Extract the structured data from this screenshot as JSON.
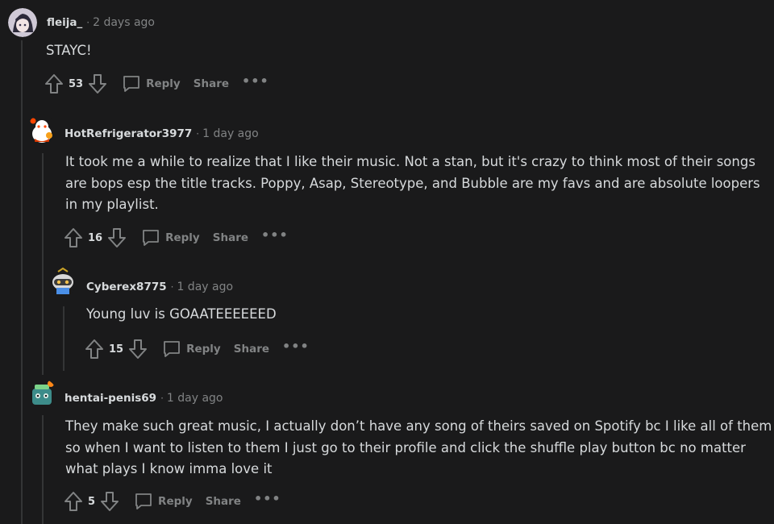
{
  "comments": [
    {
      "username": "fleija_",
      "separator": "·",
      "time": "2 days ago",
      "body": "STAYC!",
      "votes": "53",
      "reply_label": "Reply",
      "share_label": "Share",
      "more_label": "•••"
    },
    {
      "username": "HotRefrigerator3977",
      "separator": "·",
      "time": "1 day ago",
      "body": "It took me a while to realize that I like their music. Not a stan, but it's crazy to think most of their songs\nare bops esp the title tracks. Poppy, Asap, Stereotype, and Bubble are my favs and are absolute loopers\nin my playlist.",
      "votes": "16",
      "reply_label": "Reply",
      "share_label": "Share",
      "more_label": "•••"
    },
    {
      "username": "Cyberex8775",
      "separator": "·",
      "time": "1 day ago",
      "body": "Young luv is GOAATEEEEEED",
      "votes": "15",
      "reply_label": "Reply",
      "share_label": "Share",
      "more_label": "•••"
    },
    {
      "username": "hentai-penis69",
      "separator": "·",
      "time": "1 day ago",
      "body": "They make such great music, I actually don’t have any song of theirs saved on Spotify bc I like all of them\nso when I want to listen to them I just go to their profile and click the shuffle play button bc no matter\nwhat plays I know imma love it",
      "votes": "5",
      "reply_label": "Reply",
      "share_label": "Share",
      "more_label": "•••"
    }
  ],
  "icons": {
    "upvote": "upvote-arrow-icon",
    "downvote": "downvote-arrow-icon",
    "reply": "speech-bubble-icon"
  },
  "colors": {
    "background": "#1a1a1b",
    "text": "#d7dadc",
    "muted": "#818384",
    "thread_line": "#343536"
  }
}
